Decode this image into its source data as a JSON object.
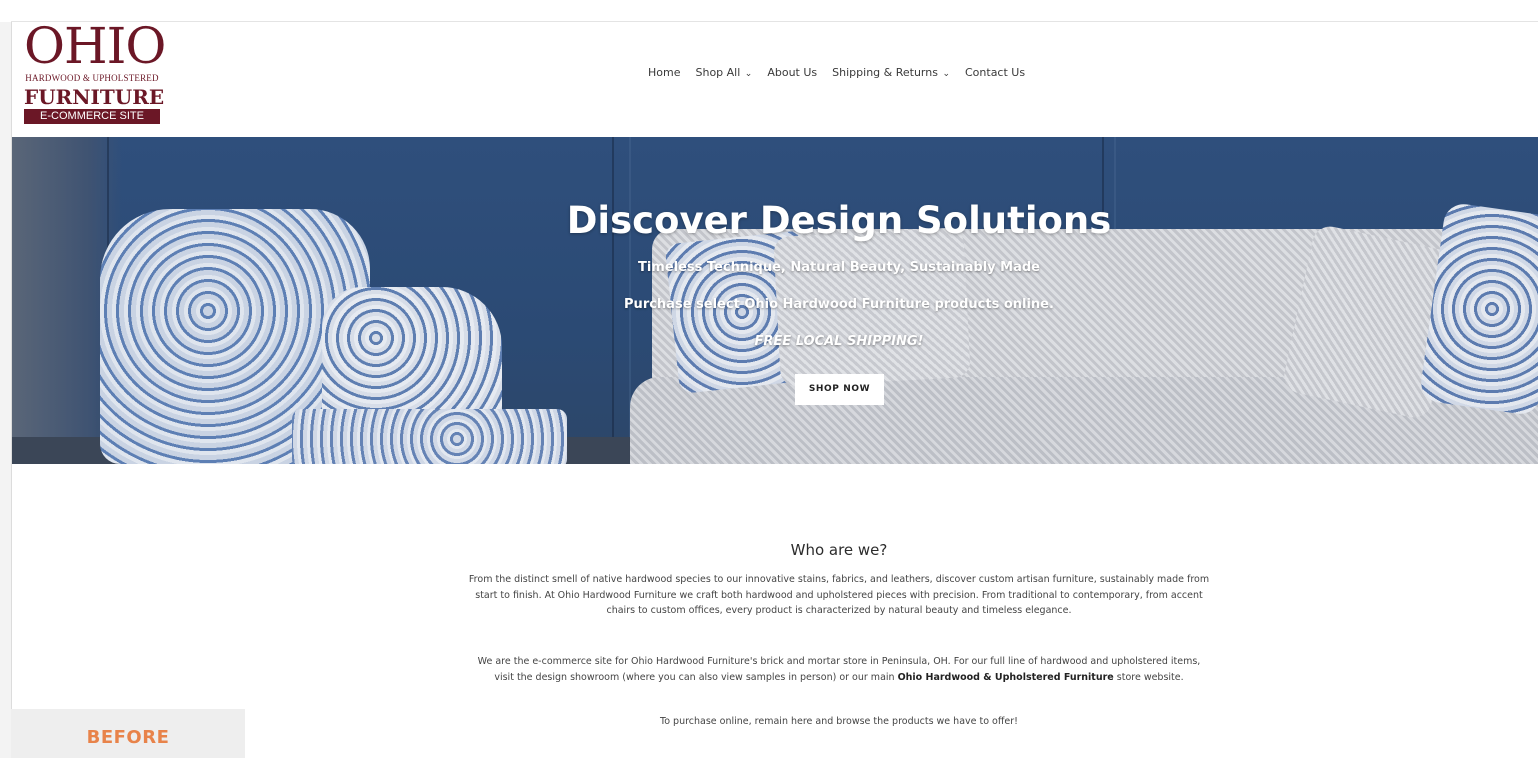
{
  "logo": {
    "line1": "OHIO",
    "line2": "HARDWOOD & UPHOLSTERED",
    "line3": "FURNITURE",
    "line4": "E-COMMERCE SITE"
  },
  "nav": {
    "items": [
      {
        "label": "Home"
      },
      {
        "label": "Shop All",
        "dropdown": true
      },
      {
        "label": "About Us"
      },
      {
        "label": "Shipping & Returns",
        "dropdown": true
      },
      {
        "label": "Contact Us"
      }
    ],
    "chevron": "⌄"
  },
  "hero": {
    "title": "Discover Design Solutions",
    "subtitle": "Timeless Technique, Natural Beauty, Sustainably Made",
    "purchase_line": "Purchase select Ohio Hardwood Furniture products online.",
    "free_shipping": "FREE LOCAL SHIPPING!",
    "cta_label": "SHOP NOW"
  },
  "about": {
    "heading": "Who are we?",
    "paragraph1": "From the distinct smell of native hardwood species to our innovative stains, fabrics, and leathers, discover custom artisan furniture, sustainably made from start to finish. At Ohio Hardwood Furniture we craft both hardwood and upholstered pieces with precision. From traditional to contemporary, from accent chairs to custom offices, every product is characterized by natural beauty and timeless elegance.",
    "paragraph2_before": "We are the e-commerce site for Ohio Hardwood Furniture's brick and mortar store in Peninsula, OH. For our full line of hardwood and upholstered items, visit the design showroom (where you can also view samples in person) or our main ",
    "paragraph2_bold": "Ohio Hardwood & Upholstered Furniture",
    "paragraph2_after": " store website.",
    "paragraph3": "To purchase online, remain here and browse the products we have to offer!"
  },
  "badge": {
    "label": "BEFORE"
  },
  "colors": {
    "brand_maroon": "#6b1726",
    "hero_blue": "#2f4f7c",
    "badge_orange": "#e8834a"
  }
}
